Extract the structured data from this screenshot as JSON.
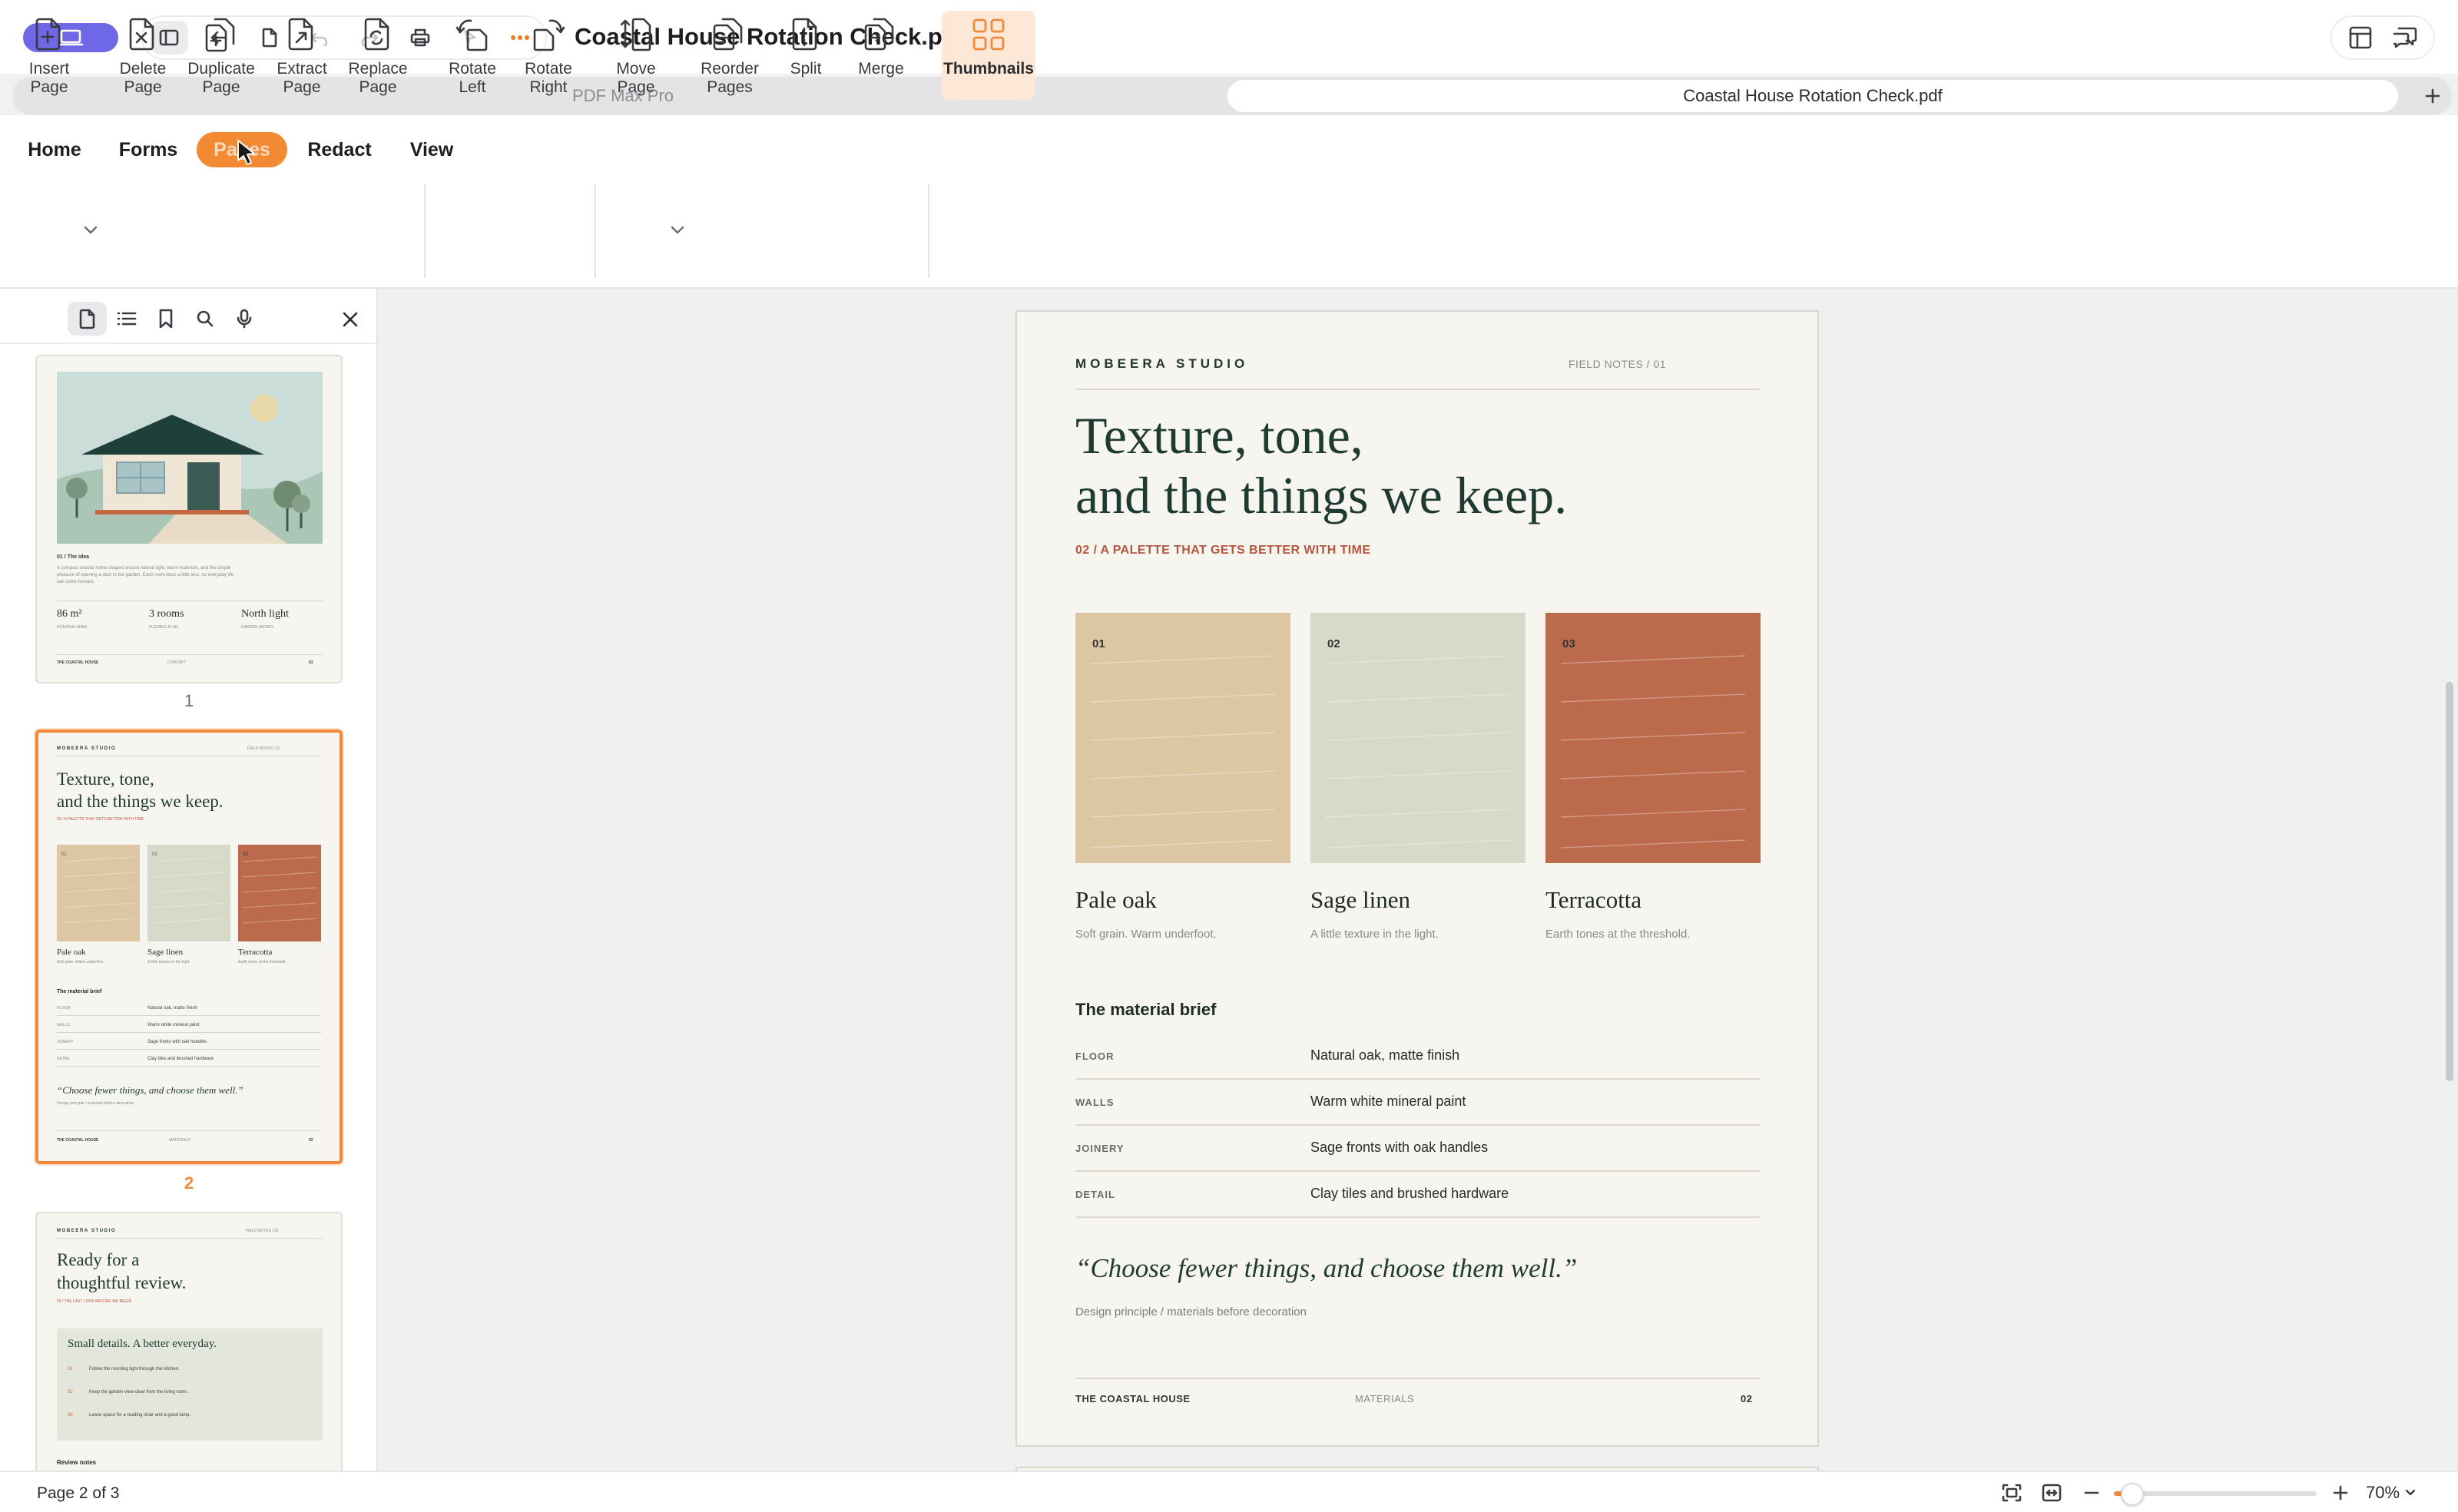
{
  "window": {
    "title": "Coastal House Rotation Check.pdf"
  },
  "tabs": [
    {
      "label": "PDF Max Pro",
      "active": false
    },
    {
      "label": "Coastal House Rotation Check.pdf",
      "active": true
    }
  ],
  "menu": {
    "items": [
      {
        "label": "Home"
      },
      {
        "label": "Forms"
      },
      {
        "label": "Pages",
        "active": true
      },
      {
        "label": "Redact"
      },
      {
        "label": "View"
      }
    ]
  },
  "ribbon": {
    "tools": [
      {
        "label": "Insert\nPage",
        "icon": "insert-page-icon",
        "has_dropdown": true
      },
      {
        "label": "Delete\nPage",
        "icon": "delete-page-icon"
      },
      {
        "label": "Duplicate\nPage",
        "icon": "duplicate-page-icon"
      },
      {
        "label": "Extract\nPage",
        "icon": "extract-page-icon"
      },
      {
        "label": "Replace\nPage",
        "icon": "replace-page-icon"
      },
      {
        "label": "Rotate\nLeft",
        "icon": "rotate-left-icon"
      },
      {
        "label": "Rotate\nRight",
        "icon": "rotate-right-icon"
      },
      {
        "label": "Move\nPage",
        "icon": "move-page-icon",
        "has_dropdown": true
      },
      {
        "label": "Reorder\nPages",
        "icon": "reorder-pages-icon"
      },
      {
        "label": "Split",
        "icon": "split-icon"
      },
      {
        "label": "Merge",
        "icon": "merge-icon"
      },
      {
        "label": "Thumbnails",
        "icon": "thumbnails-icon",
        "active": true
      }
    ]
  },
  "sidebar": {
    "toolbar": [
      "page-thumbnails-icon",
      "outline-icon",
      "bookmark-icon",
      "search-icon",
      "microphone-icon"
    ],
    "thumbnails": [
      {
        "number": "1",
        "section": "01 / The idea",
        "body": "A compact coastal home shaped around natural light, warm materials, and the simple pleasure of opening a door to the garden. Each room does a little less, so everyday life can come forward.",
        "stats": [
          {
            "value": "86 m²",
            "label": "INTERNAL AREA"
          },
          {
            "value": "3 rooms",
            "label": "FLEXIBLE PLAN"
          },
          {
            "value": "North light",
            "label": "GARDEN FACING"
          }
        ],
        "footer": [
          "THE COASTAL HOUSE",
          "CONCEPT",
          "01"
        ]
      },
      {
        "number": "2",
        "selected": true
      },
      {
        "number": "3",
        "studio": "MOBEERA STUDIO",
        "fieldnotes": "FIELD NOTES / 03",
        "headline": [
          "Ready for a",
          "thoughtful review."
        ],
        "subtitle": "03 / THE LAST LOOK BEFORE WE BEGIN",
        "card_title": "Small details. A better everyday.",
        "card_items": [
          {
            "n": "01",
            "text": "Follow the morning light through the kitchen."
          },
          {
            "n": "02",
            "text": "Keep the garden view clear from the living room."
          },
          {
            "n": "03",
            "text": "Leave space for a reading chair and a good lamp."
          }
        ],
        "notes_label": "Review notes"
      }
    ]
  },
  "page": {
    "studio": "MOBEERA STUDIO",
    "fieldnotes": "FIELD NOTES  /  01",
    "headline": [
      "Texture, tone,",
      "and the things we keep."
    ],
    "subtitle": "02 / A PALETTE THAT GETS BETTER WITH TIME",
    "swatches": [
      {
        "num": "01",
        "name": "Pale oak",
        "desc": "Soft grain. Warm underfoot.",
        "color": "#dcc6a4"
      },
      {
        "num": "02",
        "name": "Sage linen",
        "desc": "A little texture in the light.",
        "color": "#d7d9ca"
      },
      {
        "num": "03",
        "name": "Terracotta",
        "desc": "Earth tones at the threshold.",
        "color": "#bc6a4c"
      }
    ],
    "brief_title": "The material brief",
    "brief": [
      {
        "key": "FLOOR",
        "value": "Natural oak, matte finish"
      },
      {
        "key": "WALLS",
        "value": "Warm white mineral paint"
      },
      {
        "key": "JOINERY",
        "value": "Sage fronts with oak handles"
      },
      {
        "key": "DETAIL",
        "value": "Clay tiles and brushed hardware"
      }
    ],
    "quote": "“Choose fewer things, and choose them well.”",
    "quote_sub": "Design principle / materials before decoration",
    "footer_left": "THE COASTAL HOUSE",
    "footer_mid": "MATERIALS",
    "footer_right": "02"
  },
  "status": {
    "page_indicator": "Page 2 of 3",
    "zoom_value": "70%",
    "zoom_level": 0.09
  },
  "colors": {
    "accent": "#f08a3a",
    "app_badge": "#6e67e6",
    "heading_green": "#1f3a32",
    "terracotta": "#bc6a4c"
  }
}
